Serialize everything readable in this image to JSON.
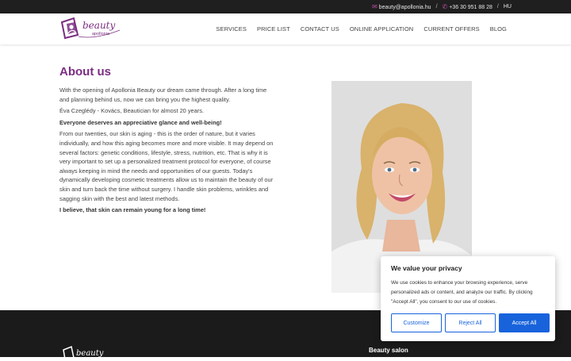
{
  "topbar": {
    "email": "beauty@apollonia.hu",
    "phone": "+36 30 951 88 28",
    "language": "HU",
    "separator": "/"
  },
  "brand": {
    "logo_script": "beauty",
    "logo_sub": "apollonia",
    "accent_color": "#7b2d82"
  },
  "nav": {
    "items": [
      {
        "label": "SERVICES"
      },
      {
        "label": "PRICE LIST"
      },
      {
        "label": "CONTACT US"
      },
      {
        "label": "ONLINE APPLICATION"
      },
      {
        "label": "CURRENT OFFERS"
      },
      {
        "label": "BLOG"
      }
    ]
  },
  "about": {
    "title": "About us",
    "p1": "With the opening of Apollonia Beauty our dream came through. After a long time and planning behind us, now we can bring you the highest quality.",
    "p2": "Éva Czeglédy - Kovács, Beautician for almost 20 years.",
    "p3": "Everyone deserves an appreciative glance and well-being!",
    "p4": "From our twenties, our skin is aging - this is the order of nature, but it varies individually, and how this aging becomes more and more visible. It may depend on several factors: genetic conditions, lifestyle, stress, nutrition, etc. That is why it is very important to set up a personalized treatment protocol for everyone, of course always keeping in mind the needs and opportunities of our guests. Today's dynamically developing cosmetic treatments allow us to maintain the beauty of our skin and turn back the time without surgery. I handle skin problems, wrinkles and sagging skin with the best and latest methods.",
    "p5": "I believe, that skin can remain young for a long time!"
  },
  "footer": {
    "col2_title": "Beauty salon"
  },
  "cookie": {
    "title": "We value your privacy",
    "text": "We use cookies to enhance your browsing experience, serve personalized ads or content, and analyze our traffic. By clicking \"Accept All\", you consent to our use of cookies.",
    "customize": "Customize",
    "reject": "Reject All",
    "accept": "Accept All",
    "button_color": "#1863dc"
  }
}
